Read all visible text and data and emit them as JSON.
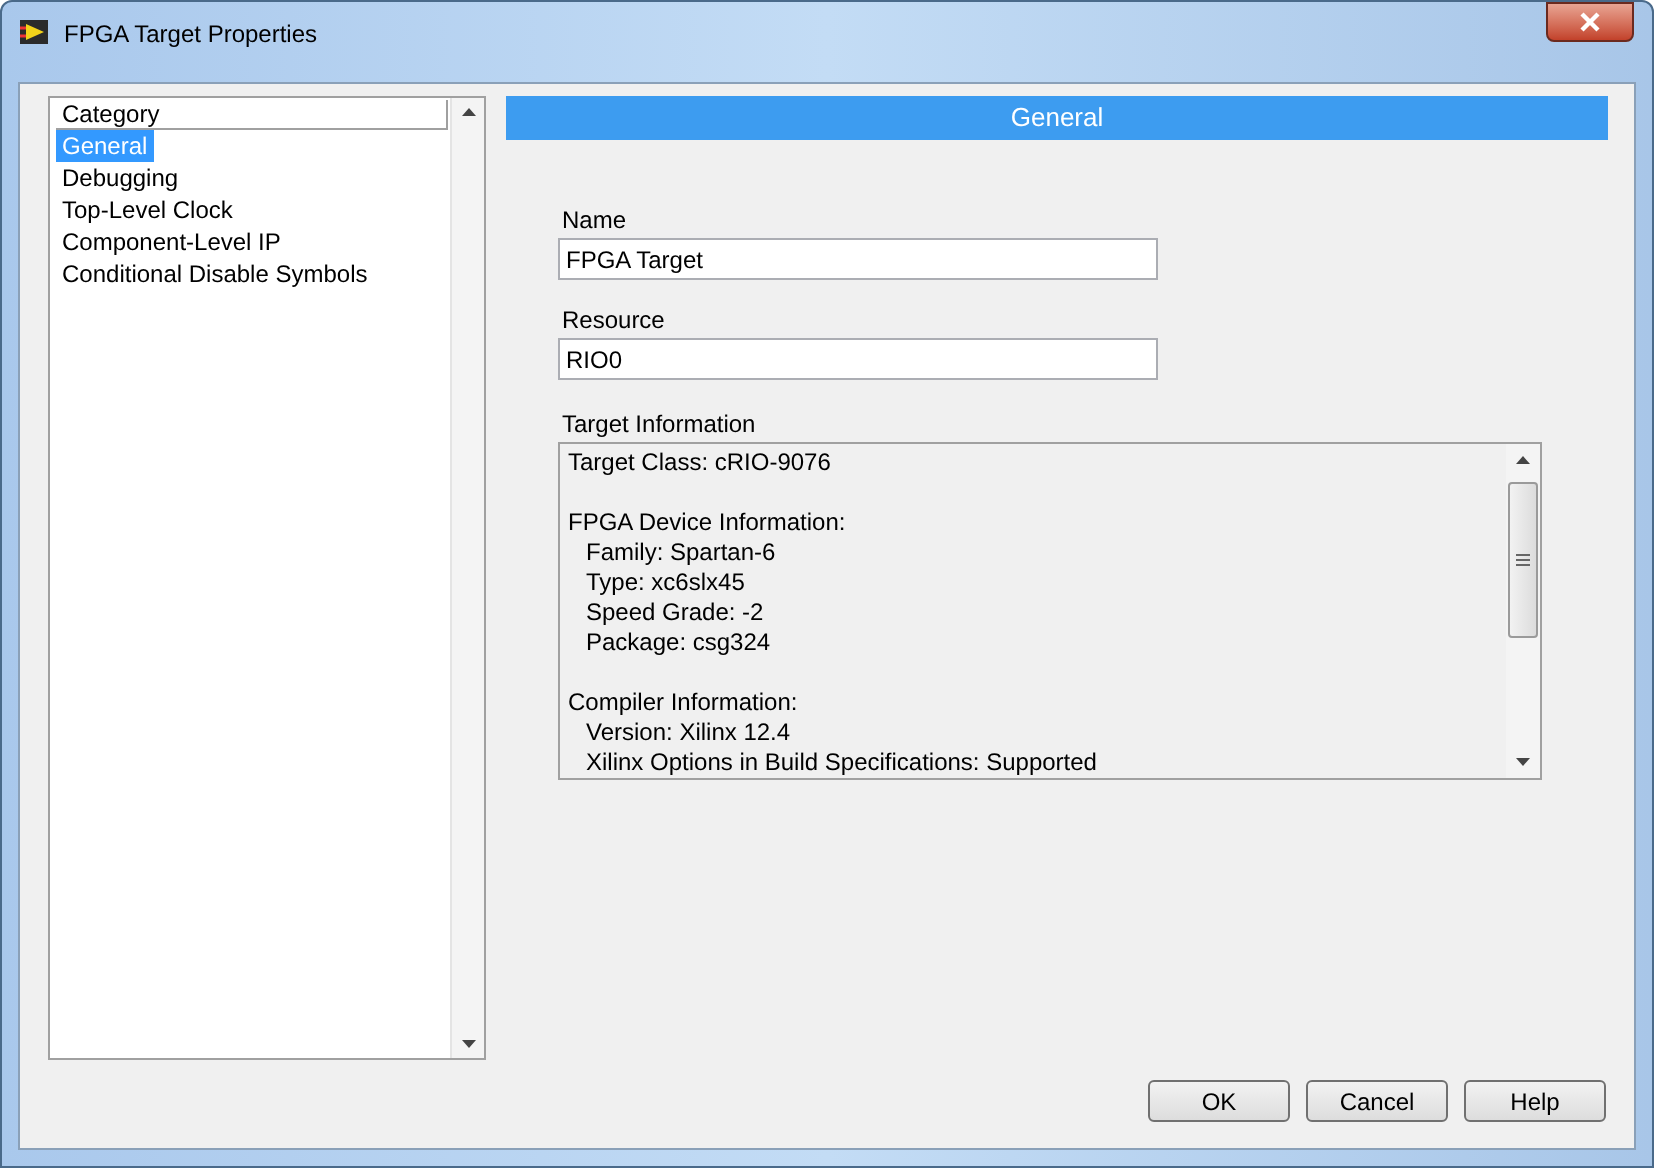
{
  "window": {
    "title": "FPGA Target Properties"
  },
  "category_list": {
    "header": "Category",
    "items": [
      {
        "label": "General",
        "selected": true
      },
      {
        "label": "Debugging",
        "selected": false
      },
      {
        "label": "Top-Level Clock",
        "selected": false
      },
      {
        "label": "Component-Level IP",
        "selected": false
      },
      {
        "label": "Conditional Disable Symbols",
        "selected": false
      }
    ]
  },
  "section_header": "General",
  "fields": [
    {
      "label": "Name",
      "value": "FPGA Target"
    },
    {
      "label": "Resource",
      "value": "RIO0"
    }
  ],
  "target_information": {
    "label": "Target Information",
    "groups": [
      {
        "text": "Target Class: cRIO-9076"
      },
      {
        "text": "FPGA Device Information:",
        "children": [
          {
            "text": "Family: Spartan-6"
          },
          {
            "text": "Type: xc6slx45"
          },
          {
            "text": "Speed Grade: -2"
          },
          {
            "text": "Package: csg324"
          }
        ]
      },
      {
        "text": "Compiler Information:",
        "children": [
          {
            "text": "Version: Xilinx 12.4"
          },
          {
            "text": "Xilinx Options in Build Specifications: Supported"
          }
        ]
      }
    ]
  },
  "buttons": [
    "OK",
    "Cancel",
    "Help"
  ]
}
